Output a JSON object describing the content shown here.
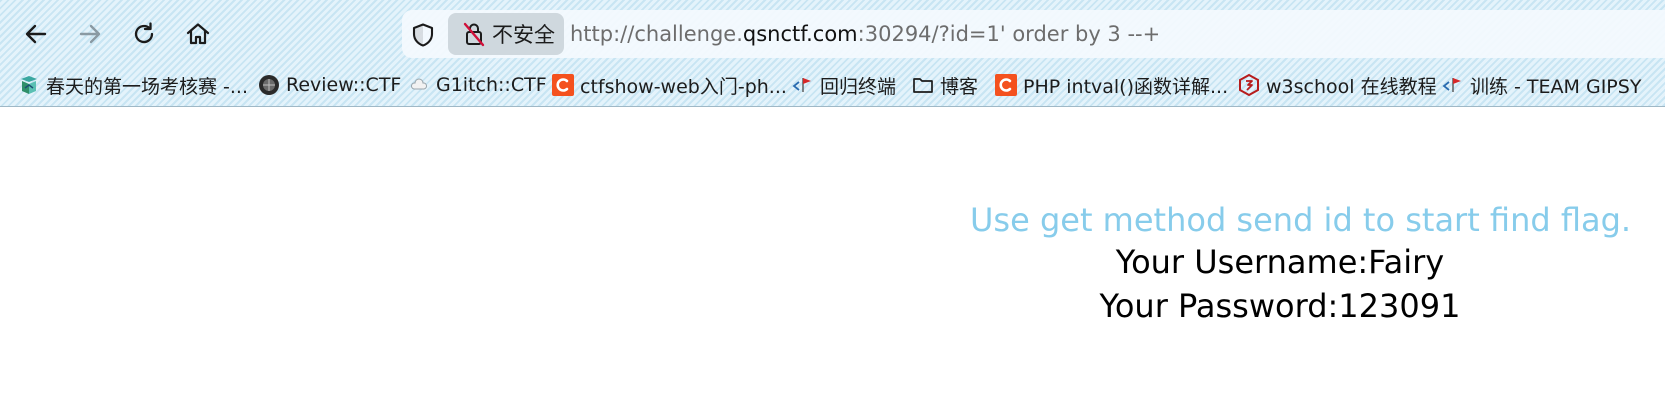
{
  "toolbar": {
    "back_icon": "arrow-left-icon",
    "forward_icon": "arrow-right-icon",
    "reload_icon": "reload-icon",
    "home_icon": "home-icon",
    "security_icon": "shield-icon",
    "insecure_label": "不安全",
    "url": {
      "prefix": "http://challenge.",
      "host": "qsnctf.com",
      "suffix": ":30294/?id=1' order by 3 --+"
    }
  },
  "bookmarks": [
    {
      "label": "春天的第一场考核赛 -...",
      "icon": "book-icon"
    },
    {
      "label": "Review::CTF",
      "icon": "globe-avatar-icon"
    },
    {
      "label": "G1itch::CTF",
      "icon": "cloud-icon"
    },
    {
      "label": "ctfshow-web入门-ph...",
      "icon": "csdn-c-icon"
    },
    {
      "label": "回归终端",
      "icon": "code-flag-icon"
    },
    {
      "label": "博客",
      "icon": "folder-icon"
    },
    {
      "label": "PHP intval()函数详解...",
      "icon": "csdn-c-icon"
    },
    {
      "label": "w3school 在线教程",
      "icon": "w3school-icon"
    },
    {
      "label": "训练 - TEAM GIPSY",
      "icon": "code-flag-icon"
    }
  ],
  "page": {
    "hint": "Use get method send id to start find flag.",
    "username_line": "Your Username:Fairy",
    "password_line": "Your Password:123091"
  },
  "colors": {
    "hint_text": "#87cceb",
    "body_text": "#000000",
    "chrome_background": "#d3ebf7"
  }
}
